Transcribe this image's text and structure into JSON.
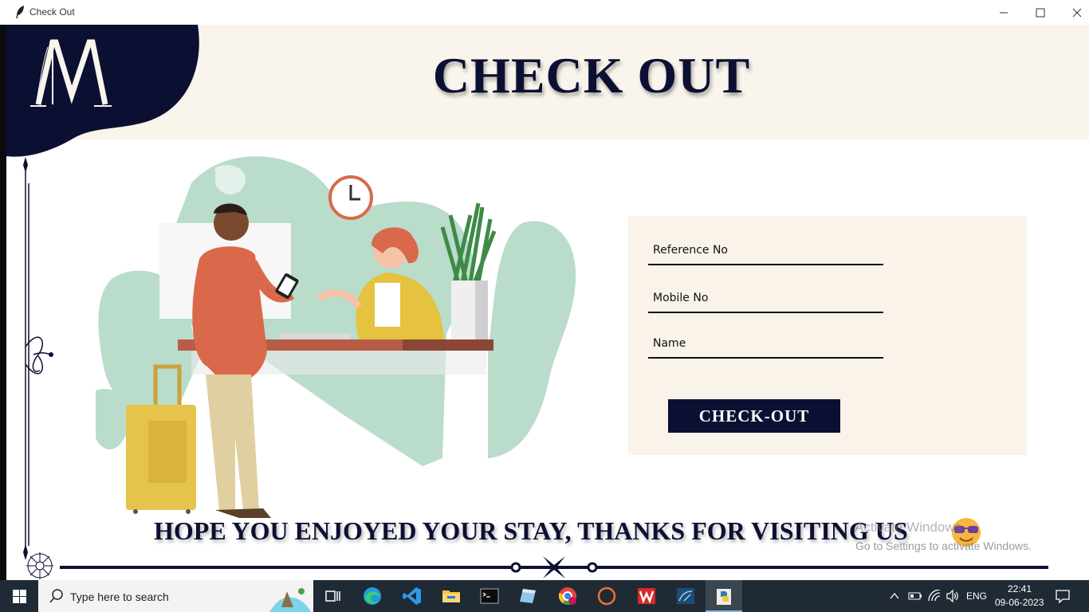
{
  "window": {
    "title": "Check Out"
  },
  "header": {
    "title": "CHECK OUT"
  },
  "form": {
    "reference_placeholder": "Reference No",
    "mobile_placeholder": "Mobile No",
    "name_placeholder": "Name",
    "submit_label": "CHECK-OUT"
  },
  "footer": {
    "message": "HOPE YOU ENJOYED YOUR STAY, THANKS FOR VISITING US"
  },
  "watermark": {
    "line1": "Activate Windows",
    "line2": "Go to Settings to activate Windows."
  },
  "taskbar": {
    "search_placeholder": "Type here to search",
    "language": "ENG",
    "time": "22:41",
    "date": "09-06-2023"
  },
  "colors": {
    "navy": "#0b1033",
    "cream": "#faf5ec",
    "panel": "#faf3ea",
    "mint": "#b9dccb"
  }
}
